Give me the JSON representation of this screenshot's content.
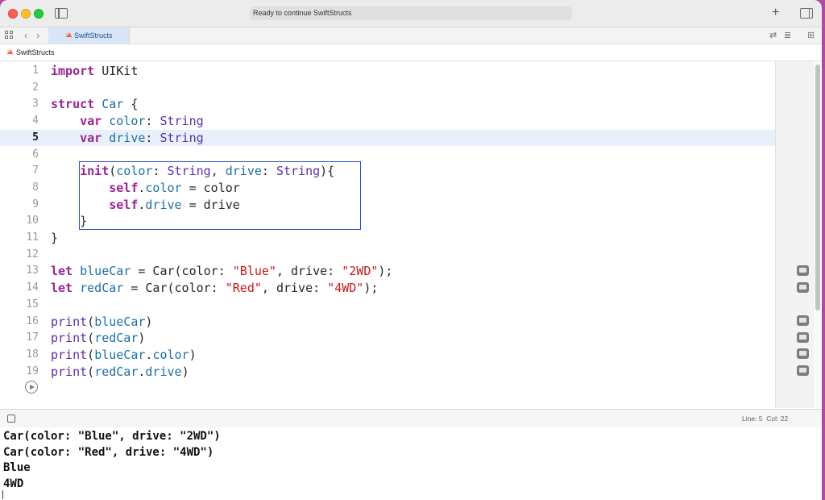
{
  "window": {
    "status_text": "Ready to continue SwiftStructs",
    "tab_label": "SwiftStructs",
    "breadcrumb": "SwiftStructs"
  },
  "colors": {
    "keyword": "#9b2393",
    "type": "#5b2ea8",
    "property": "#1f6fa3",
    "string": "#c41a16",
    "current_line": "#e8f1fb",
    "highlight_box": "#2b4ecb"
  },
  "editor": {
    "current_line": 5,
    "lines": [
      {
        "n": "1",
        "tokens": [
          {
            "t": "import",
            "c": "kw"
          },
          {
            "t": " UIKit"
          }
        ]
      },
      {
        "n": "2",
        "tokens": []
      },
      {
        "n": "3",
        "tokens": [
          {
            "t": "struct",
            "c": "kw"
          },
          {
            "t": " "
          },
          {
            "t": "Car",
            "c": "pn"
          },
          {
            "t": " {"
          }
        ]
      },
      {
        "n": "4",
        "tokens": [
          {
            "t": "    "
          },
          {
            "t": "var",
            "c": "kw"
          },
          {
            "t": " "
          },
          {
            "t": "color",
            "c": "pn"
          },
          {
            "t": ": "
          },
          {
            "t": "String",
            "c": "ty"
          }
        ]
      },
      {
        "n": "5",
        "tokens": [
          {
            "t": "    "
          },
          {
            "t": "var",
            "c": "kw"
          },
          {
            "t": " "
          },
          {
            "t": "drive",
            "c": "pn"
          },
          {
            "t": ": "
          },
          {
            "t": "String",
            "c": "ty"
          }
        ]
      },
      {
        "n": "6",
        "tokens": []
      },
      {
        "n": "7",
        "tokens": [
          {
            "t": "    "
          },
          {
            "t": "init",
            "c": "kw"
          },
          {
            "t": "("
          },
          {
            "t": "color",
            "c": "pn"
          },
          {
            "t": ": "
          },
          {
            "t": "String",
            "c": "ty"
          },
          {
            "t": ", "
          },
          {
            "t": "drive",
            "c": "pn"
          },
          {
            "t": ": "
          },
          {
            "t": "String",
            "c": "ty"
          },
          {
            "t": "){"
          }
        ]
      },
      {
        "n": "8",
        "tokens": [
          {
            "t": "        "
          },
          {
            "t": "self",
            "c": "kw"
          },
          {
            "t": "."
          },
          {
            "t": "color",
            "c": "pn"
          },
          {
            "t": " = color"
          }
        ]
      },
      {
        "n": "9",
        "tokens": [
          {
            "t": "        "
          },
          {
            "t": "self",
            "c": "kw"
          },
          {
            "t": "."
          },
          {
            "t": "drive",
            "c": "pn"
          },
          {
            "t": " = drive"
          }
        ]
      },
      {
        "n": "10",
        "tokens": [
          {
            "t": "    }"
          }
        ]
      },
      {
        "n": "11",
        "tokens": [
          {
            "t": "}"
          }
        ]
      },
      {
        "n": "12",
        "tokens": []
      },
      {
        "n": "13",
        "tokens": [
          {
            "t": "let",
            "c": "kw"
          },
          {
            "t": " "
          },
          {
            "t": "blueCar",
            "c": "pn"
          },
          {
            "t": " = Car(color: "
          },
          {
            "t": "\"Blue\"",
            "c": "str"
          },
          {
            "t": ", drive: "
          },
          {
            "t": "\"2WD\"",
            "c": "str"
          },
          {
            "t": ");"
          }
        ]
      },
      {
        "n": "14",
        "tokens": [
          {
            "t": "let",
            "c": "kw"
          },
          {
            "t": " "
          },
          {
            "t": "redCar",
            "c": "pn"
          },
          {
            "t": " = Car(color: "
          },
          {
            "t": "\"Red\"",
            "c": "str"
          },
          {
            "t": ", drive: "
          },
          {
            "t": "\"4WD\"",
            "c": "str"
          },
          {
            "t": ");"
          }
        ]
      },
      {
        "n": "15",
        "tokens": []
      },
      {
        "n": "16",
        "tokens": [
          {
            "t": "print",
            "c": "ty"
          },
          {
            "t": "("
          },
          {
            "t": "blueCar",
            "c": "pn"
          },
          {
            "t": ")"
          }
        ]
      },
      {
        "n": "17",
        "tokens": [
          {
            "t": "print",
            "c": "ty"
          },
          {
            "t": "("
          },
          {
            "t": "redCar",
            "c": "pn"
          },
          {
            "t": ")"
          }
        ]
      },
      {
        "n": "18",
        "tokens": [
          {
            "t": "print",
            "c": "ty"
          },
          {
            "t": "("
          },
          {
            "t": "blueCar",
            "c": "pn"
          },
          {
            "t": "."
          },
          {
            "t": "color",
            "c": "pn"
          },
          {
            "t": ")"
          }
        ]
      },
      {
        "n": "19",
        "tokens": [
          {
            "t": "print",
            "c": "ty"
          },
          {
            "t": "("
          },
          {
            "t": "redCar",
            "c": "pn"
          },
          {
            "t": "."
          },
          {
            "t": "drive",
            "c": "pn"
          },
          {
            "t": ")"
          }
        ]
      }
    ]
  },
  "status": {
    "line_col": "Line: 5  Col: 22"
  },
  "console": {
    "lines": [
      "Car(color: \"Blue\", drive: \"2WD\")",
      "Car(color: \"Red\", drive: \"4WD\")",
      "Blue",
      "4WD"
    ]
  },
  "icons": {
    "sidebar": "sidebar-icon",
    "add": "plus-icon",
    "inspector": "inspector-icon",
    "grid": "grid-icon",
    "back": "chevron-left-icon",
    "forward": "chevron-right-icon",
    "swift": "swift-icon",
    "result": "result-view-icon",
    "run": "play-icon"
  }
}
